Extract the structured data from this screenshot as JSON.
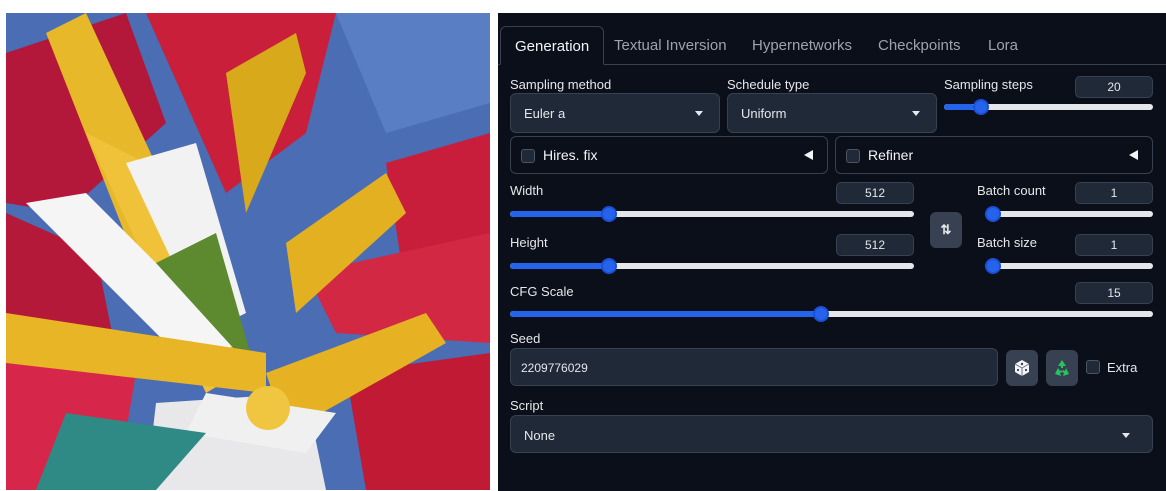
{
  "tabs": [
    "Generation",
    "Textual Inversion",
    "Hypernetworks",
    "Checkpoints",
    "Lora"
  ],
  "sampling": {
    "method_label": "Sampling method",
    "method_value": "Euler a",
    "schedule_label": "Schedule type",
    "schedule_value": "Uniform",
    "steps_label": "Sampling steps",
    "steps_value": "20",
    "steps_fraction": 0.15
  },
  "accordions": {
    "hires_label": "Hires. fix",
    "refiner_label": "Refiner"
  },
  "dimensions": {
    "width_label": "Width",
    "width_value": "512",
    "width_fraction": 0.235,
    "height_label": "Height",
    "height_value": "512",
    "height_fraction": 0.235,
    "batch_count_label": "Batch count",
    "batch_count_value": "1",
    "batch_count_fraction": 0.0,
    "batch_size_label": "Batch size",
    "batch_size_value": "1",
    "batch_size_fraction": 0.0,
    "swap_label": "⇅"
  },
  "cfg": {
    "label": "CFG Scale",
    "value": "15",
    "fraction": 0.483
  },
  "seed": {
    "label": "Seed",
    "value": "2209776029",
    "extra_label": "Extra"
  },
  "script": {
    "label": "Script",
    "value": "None"
  },
  "colors": {
    "accent": "#2563eb",
    "panel_bg": "#0b0f19",
    "input_bg": "#1f2937"
  },
  "icons": {
    "dice": "dice-icon",
    "recycle": "recycle-icon"
  }
}
